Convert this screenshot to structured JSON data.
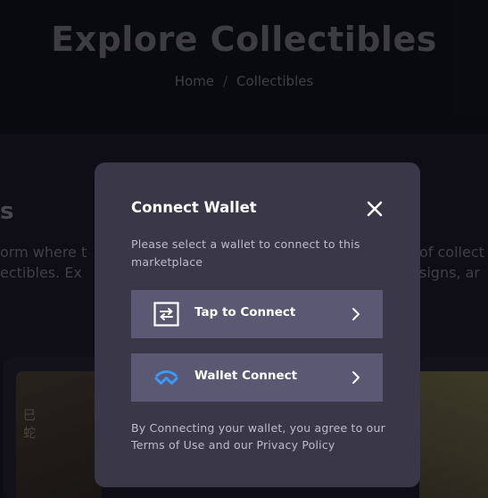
{
  "background": {
    "title": "Explore Collectibles",
    "breadcrumb": {
      "home": "Home",
      "separator": "/",
      "current": "Collectibles"
    },
    "section_heading_fragment": "s",
    "line1_left": "orm where t",
    "line2_left": "ectibles. Ex",
    "line1_right": "of collect",
    "line2_right": "signs, ar",
    "card_kanji": "巳\n蛇"
  },
  "modal": {
    "title": "Connect Wallet",
    "close_icon": "close-icon",
    "description": "Please select a wallet to connect to this marketplace",
    "options": [
      {
        "label": "Tap to Connect",
        "icon": "swap-arrows-icon"
      },
      {
        "label": "Wallet Connect",
        "icon": "walletconnect-icon"
      }
    ],
    "footer": "By Connecting your wallet, you agree to our Terms of Use and our Privacy Policy"
  },
  "colors": {
    "modal_bg": "#3a3848",
    "option_bg": "#5a5873",
    "walletconnect_blue": "#3b99fc",
    "text_muted": "#bdbcc8"
  }
}
